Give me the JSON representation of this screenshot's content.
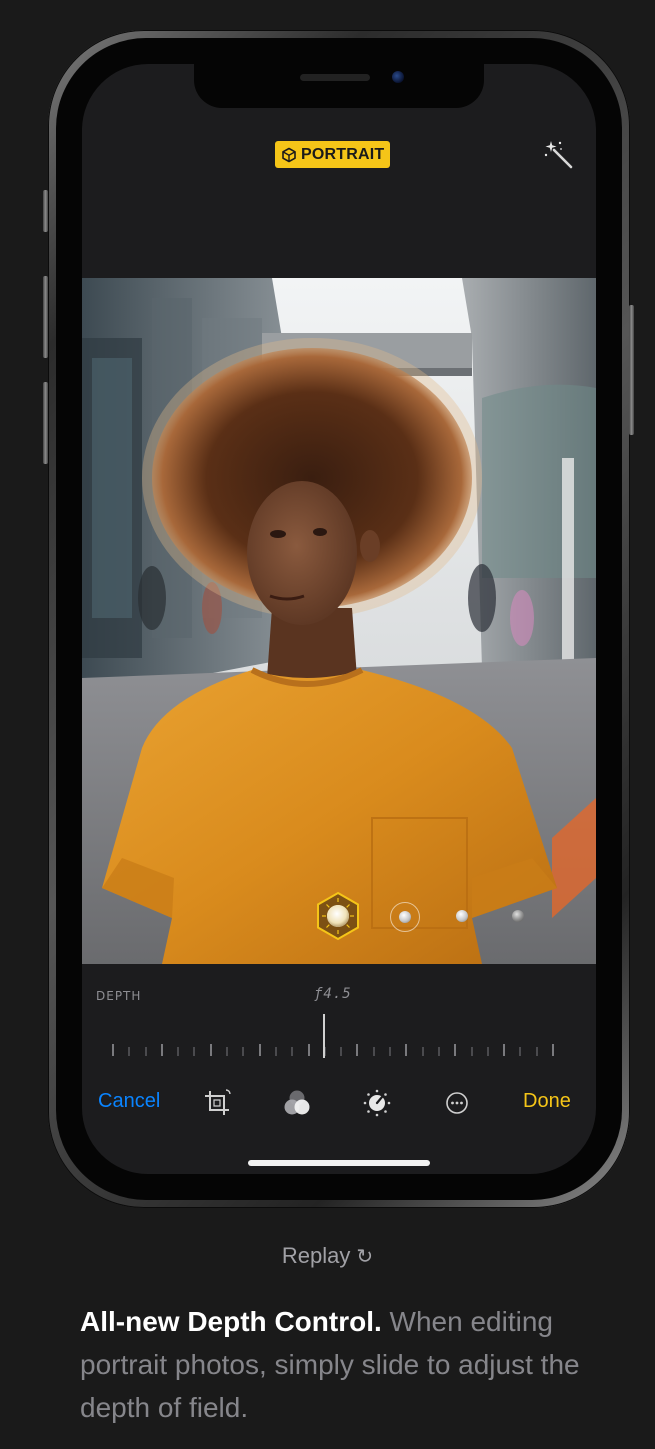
{
  "editor": {
    "mode_badge": "PORTRAIT",
    "mode_badge_icon": "cube-icon",
    "auto_enhance_icon": "magic-wand-icon"
  },
  "depth_control": {
    "label": "DEPTH",
    "fstop": "ƒ4.5",
    "slider_position": 0.48
  },
  "lighting": {
    "options": [
      "natural-light",
      "studio-light",
      "contour-light",
      "stage-light"
    ],
    "selected_index": 0
  },
  "toolbar": {
    "cancel_label": "Cancel",
    "done_label": "Done",
    "tools": [
      "crop-icon",
      "filters-icon",
      "adjust-icon",
      "more-icon"
    ]
  },
  "colors": {
    "accent_yellow": "#f5c518",
    "accent_blue": "#0a84ff",
    "background": "#1a1a1a"
  },
  "page": {
    "replay_label": "Replay",
    "replay_icon": "replay-icon",
    "caption_lead": "All-new Depth Control.",
    "caption_body": " When editing portrait photos, simply slide to adjust the depth of field."
  }
}
